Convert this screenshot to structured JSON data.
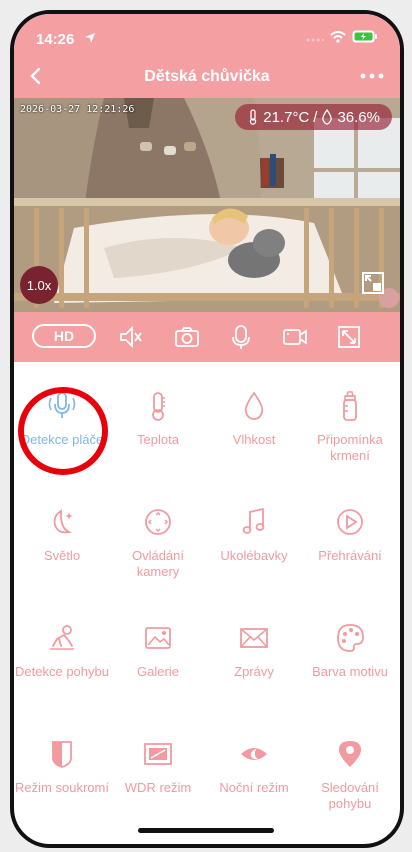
{
  "status": {
    "time": "14:26"
  },
  "nav": {
    "title": "Dětská chůvička"
  },
  "video": {
    "timestamp": "2026-03-27  12:21:26",
    "temperature": "21.7°C",
    "separator": "/",
    "humidity": "36.6%",
    "zoom": "1.0x"
  },
  "controls": {
    "hd_label": "HD"
  },
  "features": [
    {
      "label": "Detekce pláče",
      "icon": "microphone-icon",
      "active": true
    },
    {
      "label": "Teplota",
      "icon": "thermometer-icon"
    },
    {
      "label": "Vlhkost",
      "icon": "droplet-icon"
    },
    {
      "label": "Připomínka krmení",
      "icon": "baby-bottle-icon"
    },
    {
      "label": "Světlo",
      "icon": "moon-star-icon"
    },
    {
      "label": "Ovládání kamery",
      "icon": "dpad-icon"
    },
    {
      "label": "Ukolébavky",
      "icon": "music-note-icon"
    },
    {
      "label": "Přehrávání",
      "icon": "play-circle-icon"
    },
    {
      "label": "Detekce pohybu",
      "icon": "crawling-baby-icon"
    },
    {
      "label": "Galerie",
      "icon": "image-icon"
    },
    {
      "label": "Zprávy",
      "icon": "envelope-icon"
    },
    {
      "label": "Barva motivu",
      "icon": "palette-icon"
    },
    {
      "label": "Režim soukromí",
      "icon": "privacy-shield-icon"
    },
    {
      "label": "WDR režim",
      "icon": "wdr-icon"
    },
    {
      "label": "Noční režim",
      "icon": "night-eye-icon"
    },
    {
      "label": "Sledování pohybu",
      "icon": "location-pin-icon"
    }
  ],
  "colors": {
    "accent": "#f4a0a3",
    "label": "#f29aa0",
    "active": "#7fb6ec",
    "highlight_ring": "#e8000b"
  }
}
